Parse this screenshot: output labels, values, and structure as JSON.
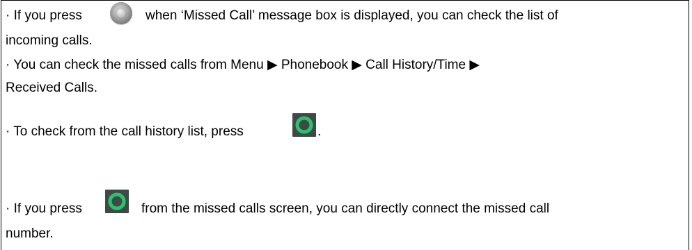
{
  "note": {
    "line1": {
      "before": "· If you press",
      "icon": "menu-knob-icon",
      "after": "when ‘Missed Call’ message box is displayed, you can check the list of"
    },
    "line2": "incoming calls.",
    "line3": "· You can check the missed calls from Menu ▶ Phonebook ▶ Call History/Time ▶",
    "line4": "Received Calls.",
    "line5": {
      "before": "· To check from the call history list, press",
      "icon": "call-green-icon",
      "after": "."
    },
    "line6": {
      "before": "· If you press",
      "icon": "call-green-icon",
      "after": "from the missed calls screen, you can directly connect the missed call"
    },
    "line7": "number."
  },
  "colors": {
    "border": "#000000",
    "call_icon_bg": "#3f4a46",
    "call_icon_green": "#28c46b"
  }
}
